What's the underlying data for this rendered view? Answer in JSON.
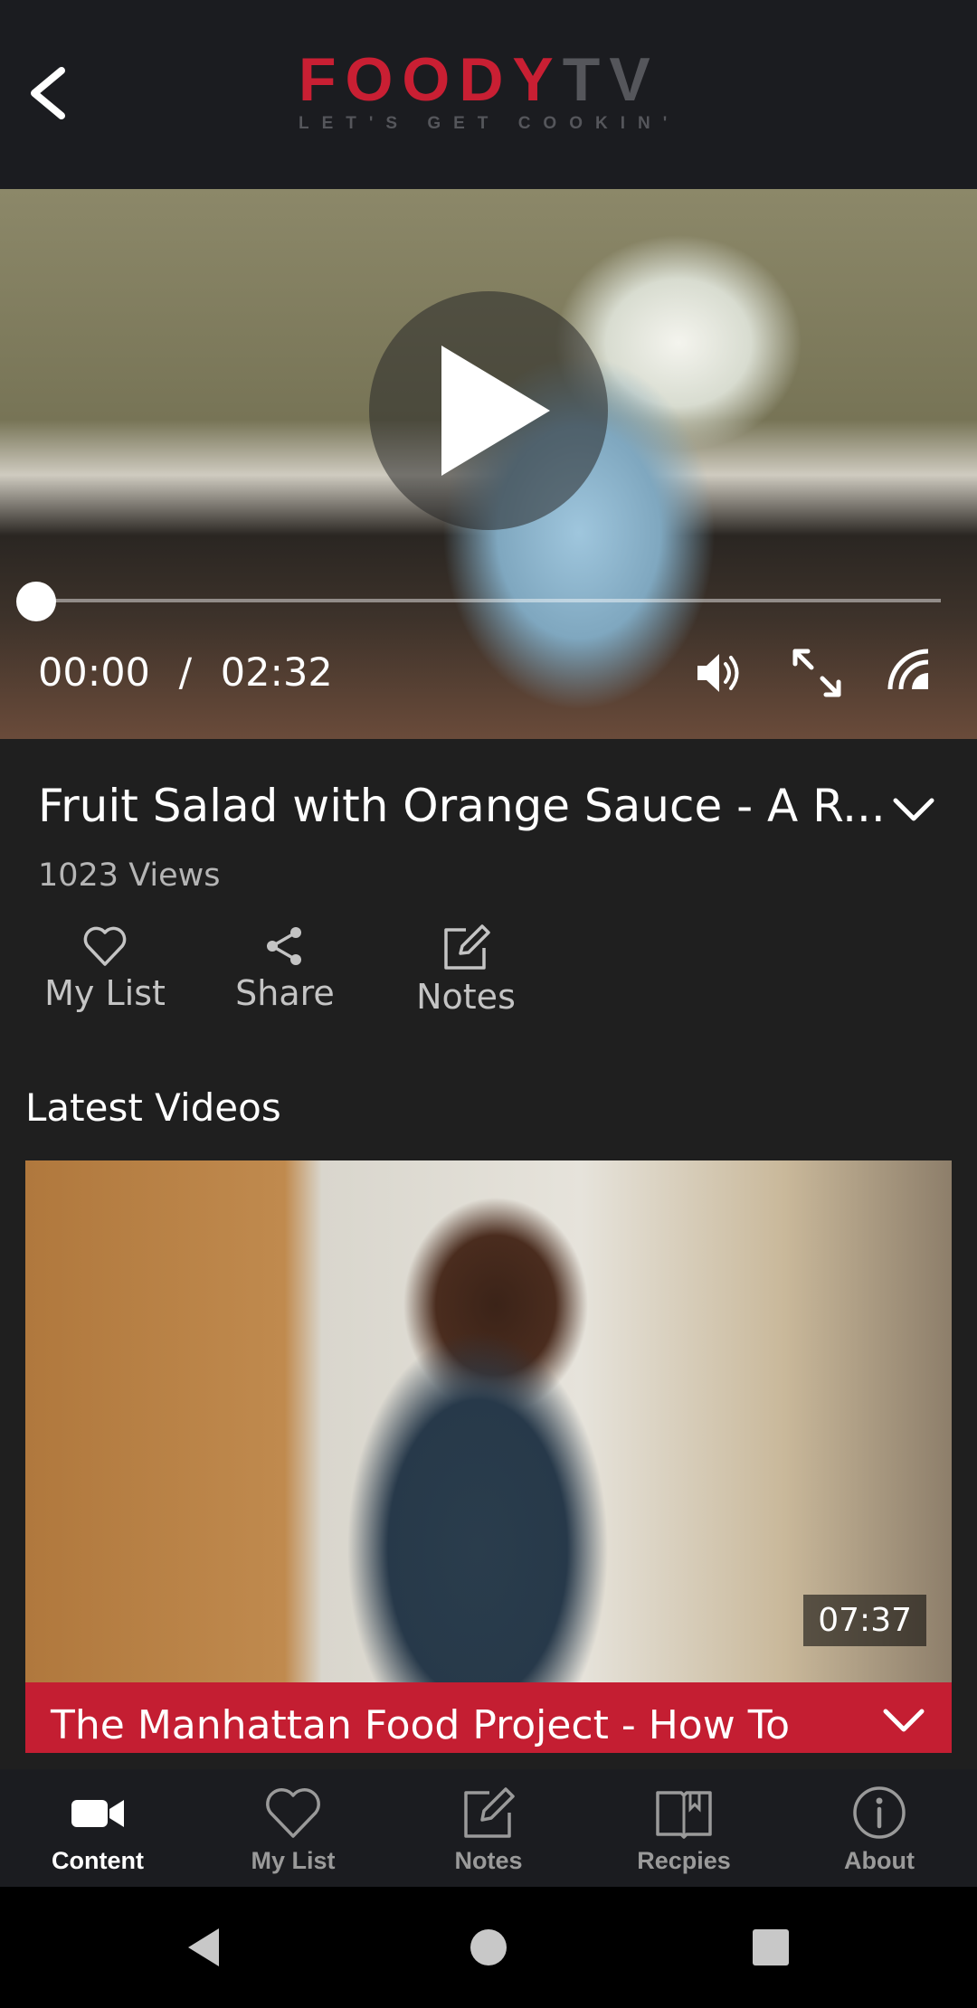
{
  "header": {
    "logo_primary": "FOODY",
    "logo_secondary": "TV",
    "tagline": "LET'S GET COOKIN'",
    "back_icon": "chevron-left-icon"
  },
  "player": {
    "current_time": "00:00",
    "separator": "/",
    "duration": "02:32",
    "progress": 0,
    "icons": [
      "play-icon",
      "volume-icon",
      "fullscreen-icon",
      "cast-icon"
    ]
  },
  "video": {
    "title": "Fruit Salad with Orange Sauce - A R...",
    "views": "1023 Views"
  },
  "actions": [
    {
      "label": "My List",
      "icon": "heart-icon"
    },
    {
      "label": "Share",
      "icon": "share-icon"
    },
    {
      "label": "Notes",
      "icon": "edit-icon"
    }
  ],
  "latest": {
    "section_title": "Latest Videos",
    "items": [
      {
        "title": "The Manhattan Food Project - How To",
        "duration": "07:37"
      }
    ]
  },
  "bottom_nav": [
    {
      "label": "Content",
      "icon": "video-camera-icon",
      "active": true
    },
    {
      "label": "My List",
      "icon": "heart-icon",
      "active": false
    },
    {
      "label": "Notes",
      "icon": "edit-icon",
      "active": false
    },
    {
      "label": "Recpies",
      "icon": "book-icon",
      "active": false
    },
    {
      "label": "About",
      "icon": "info-icon",
      "active": false
    }
  ],
  "colors": {
    "brand_red": "#c91f33",
    "header_bg": "#1b1c20",
    "page_bg": "#1f1f1f",
    "card_bar": "#c41e32"
  }
}
